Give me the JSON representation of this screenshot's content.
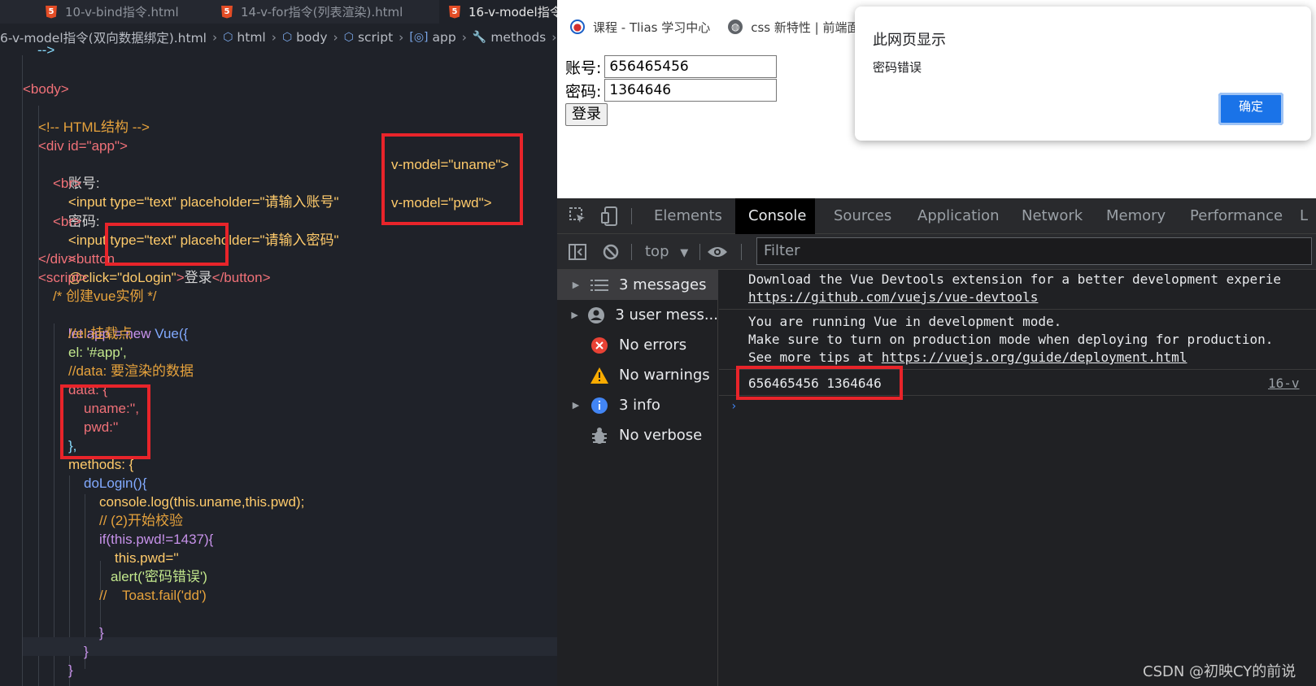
{
  "editor": {
    "tabs": [
      {
        "label": "10-v-bind指令.html"
      },
      {
        "label": "14-v-for指令(列表渲染).html"
      },
      {
        "label": "16-v-model指令"
      }
    ],
    "breadcrumb": [
      "6-v-model指令(双向数据绑定).html",
      "html",
      "body",
      "script",
      "app",
      "methods"
    ],
    "code": {
      "l0": "-->",
      "l1_open": "<body>",
      "l2_comment": "<!-- HTML结构 -->",
      "l3": "<div id=\"app\">",
      "l4_label": "账号:",
      "l4_code": "<input type=\"text\" placeholder=\"请输入账号\"",
      "l4_model": "v-model=\"uname\">",
      "l5": "<br>",
      "l6_label": "密码:",
      "l6_code": "<input type=\"text\" placeholder=\"请输入密码\"",
      "l6_model": "v-model=\"pwd\">",
      "l7": "<br>",
      "l8_a": "<button",
      "l8_b": "@click=\"doLogin\"",
      "l8_c": ">",
      "l8_d": "登录",
      "l8_e": "</button>",
      "l9": "</div>",
      "l10": "<script>",
      "l11": "/* 创建vue实例 */",
      "l12_a": "let app = new ",
      "l12_b": "Vue({",
      "l13": "//el:挂载点",
      "l14": "el: '#app',",
      "l15": "//data: 要渲染的数据",
      "l16": "data: {",
      "l17": "uname:'',",
      "l18": "pwd:''",
      "l19": "},",
      "l20": "methods: {",
      "l21": "doLogin(){",
      "l22": "console.log(this.uname,this.pwd);",
      "l23": "// (2)开始校验",
      "l24": "if(this.pwd!=1437){",
      "l25": "this.pwd=''",
      "l26": "alert('密码错误')",
      "l27": "//    Toast.fail('dd')",
      "l28": "}",
      "l29": "}",
      "l30": "}"
    }
  },
  "browser": {
    "bookmarks": [
      "课程 - Tlias 学习中心",
      "css 新特性 | 前端面"
    ],
    "form": {
      "account_label": "账号:",
      "account_value": "656465456",
      "password_label": "密码:",
      "password_value": "1364646",
      "login_button": "登录"
    },
    "alert": {
      "title": "此网页显示",
      "message": "密码错误",
      "ok_button": "确定"
    }
  },
  "devtools": {
    "tabs": [
      "Elements",
      "Console",
      "Sources",
      "Application",
      "Network",
      "Memory",
      "Performance",
      "L"
    ],
    "context": "top",
    "filter_placeholder": "Filter",
    "sidebar": [
      {
        "label": "3 messages"
      },
      {
        "label": "3 user mess..."
      },
      {
        "label": "No errors"
      },
      {
        "label": "No warnings"
      },
      {
        "label": "3 info"
      },
      {
        "label": "No verbose"
      }
    ],
    "console": {
      "m1_line1": "Download the Vue Devtools extension for a better development experie",
      "m1_link": "https://github.com/vuejs/vue-devtools",
      "m2_line1": "You are running Vue in development mode.",
      "m2_line2": "Make sure to turn on production mode when deploying for production.",
      "m2_line3_prefix": "See more tips at ",
      "m2_link": "https://vuejs.org/guide/deployment.html",
      "m3_output": "656465456 1364646",
      "m3_source": "16-v"
    }
  },
  "watermark": "CSDN @初映CY的前说",
  "colors": {
    "highlight_box": "#e8242a",
    "primary_button": "#1a73e8"
  }
}
